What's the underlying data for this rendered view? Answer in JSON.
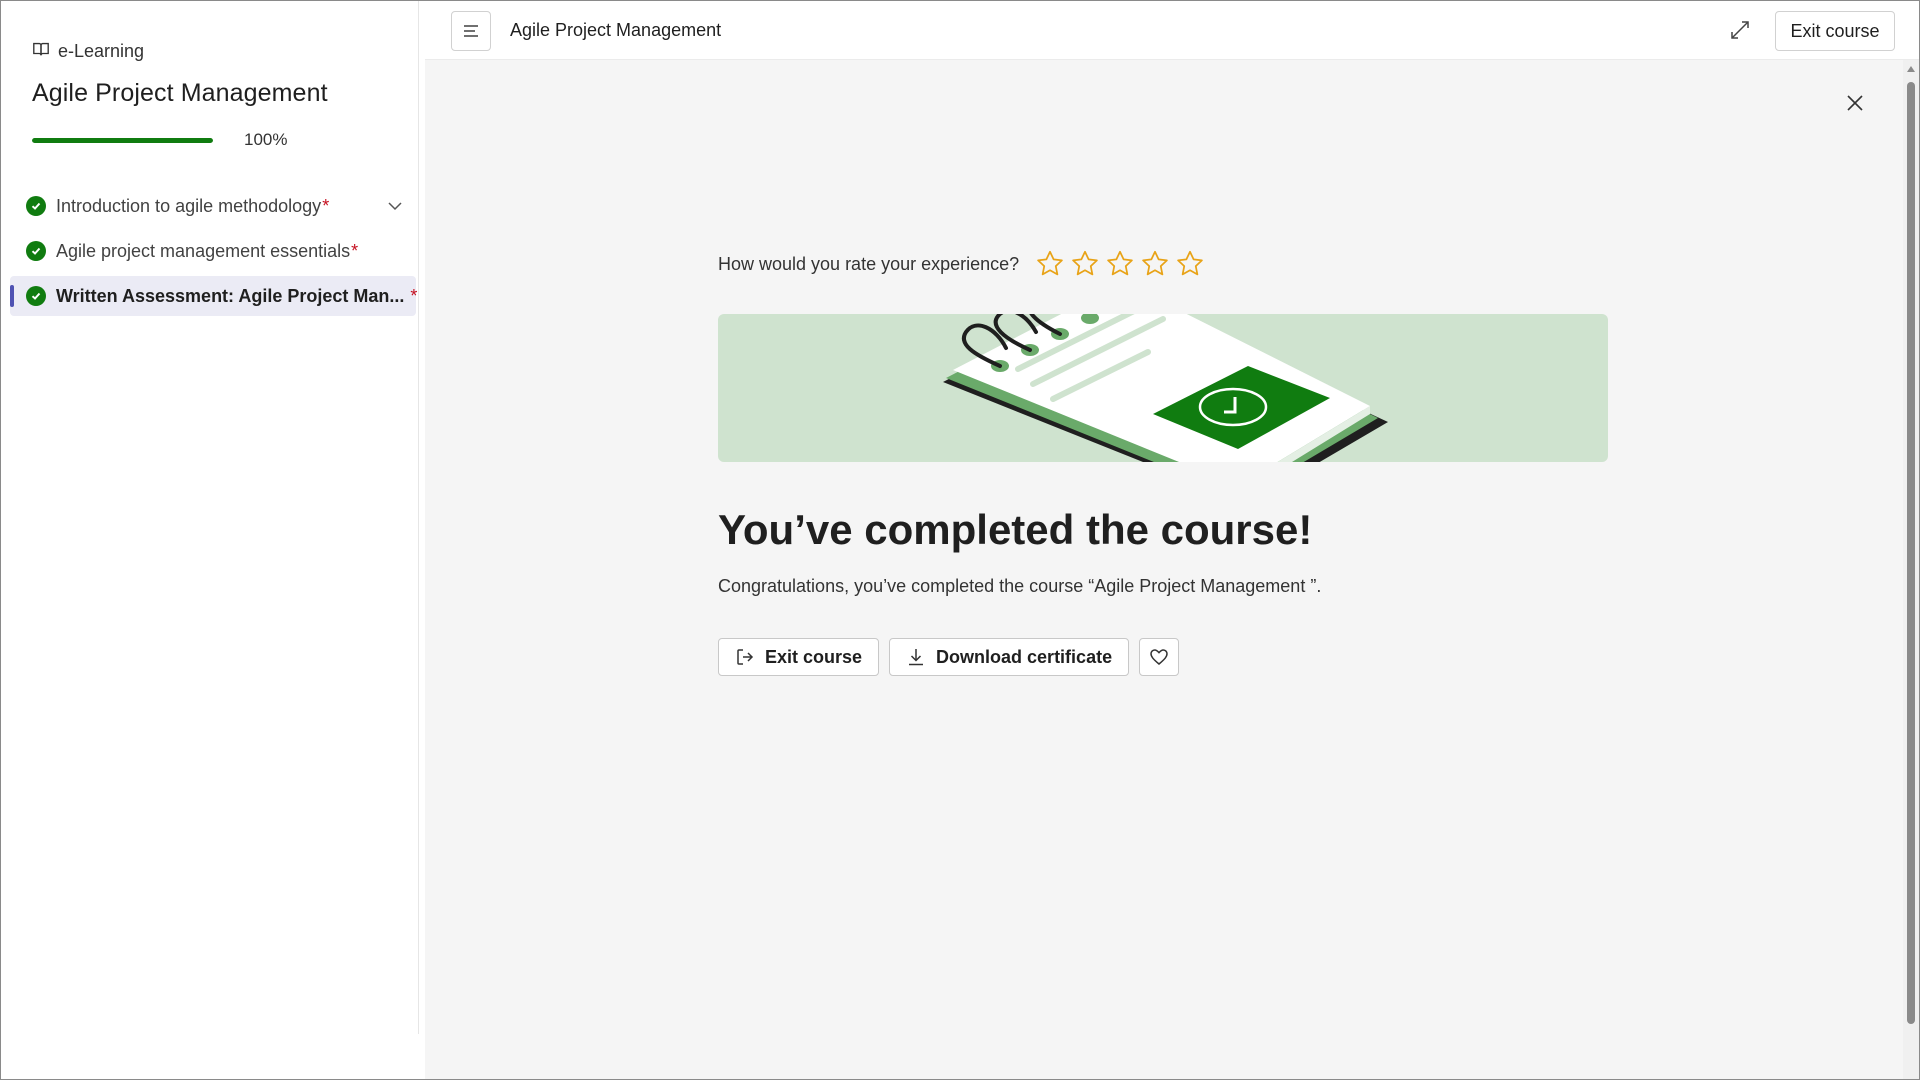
{
  "sidebar": {
    "brand": "e-Learning",
    "course_title": "Agile Project Management",
    "progress": {
      "value": 100,
      "label": "100%"
    },
    "items": [
      {
        "label": "Introduction to agile methodology",
        "required": "*",
        "completed": true,
        "expandable": true
      },
      {
        "label": "Agile project management essentials",
        "required": "*",
        "completed": true
      },
      {
        "label": "Written Assessment: Agile Project Man...",
        "required": " *",
        "completed": true,
        "active": true
      }
    ]
  },
  "topbar": {
    "title": "Agile Project Management",
    "exit_label": "Exit course"
  },
  "main": {
    "rating_question": "How would you rate your experience?",
    "stars": 5,
    "headline": "You’ve completed the course!",
    "message": "Congratulations, you’ve completed the course “Agile Project Management ”.",
    "exit_label": "Exit course",
    "download_label": "Download certificate"
  },
  "colors": {
    "accent_green": "#107c10",
    "active_indicator": "#4f52b2",
    "required": "#c50f1f",
    "banner_bg": "#cfe3cf",
    "star": "#e8a317"
  },
  "icons": {
    "brand": "book-icon",
    "menu": "menu-icon",
    "expand": "expand-icon",
    "close": "close-icon",
    "exit": "exit-icon",
    "download": "download-icon",
    "favorite": "heart-icon"
  }
}
